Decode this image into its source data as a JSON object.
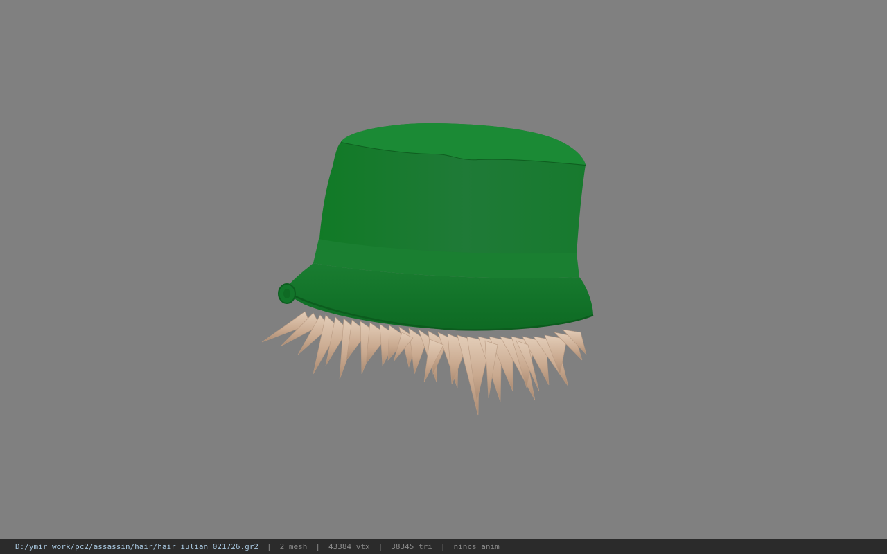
{
  "viewport": {
    "model_name": "bucket-hat-with-hair",
    "background_color": "#808080",
    "hat_color": "#1c7a30",
    "hair_color": "#c9a98f"
  },
  "statusbar": {
    "file_path": "D:/ymir work/pc2/assassin/hair/hair_iulian_021726.gr2",
    "separator": "|",
    "mesh": "2 mesh",
    "vtx": "43384 vtx",
    "tri": "38345 tri",
    "anim": "nincs anim"
  }
}
